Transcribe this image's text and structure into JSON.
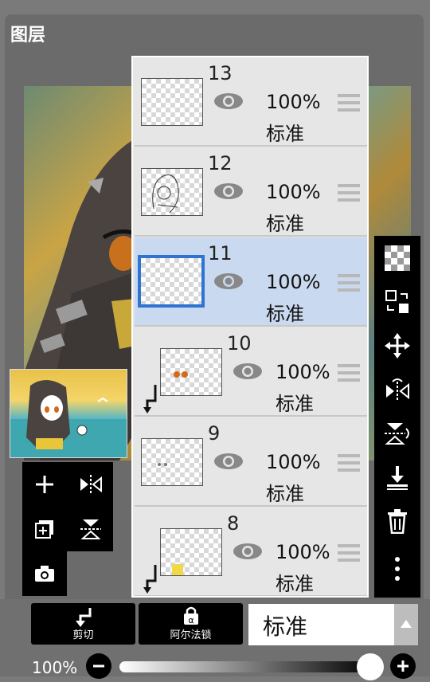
{
  "header": {
    "title": "图层"
  },
  "layers": [
    {
      "number": "13",
      "opacity": "100%",
      "mode": "标准",
      "clipped": false,
      "selected": false
    },
    {
      "number": "12",
      "opacity": "100%",
      "mode": "标准",
      "clipped": false,
      "selected": false
    },
    {
      "number": "11",
      "opacity": "100%",
      "mode": "标准",
      "clipped": false,
      "selected": true
    },
    {
      "number": "10",
      "opacity": "100%",
      "mode": "标准",
      "clipped": true,
      "selected": false
    },
    {
      "number": "9",
      "opacity": "100%",
      "mode": "标准",
      "clipped": false,
      "selected": false
    },
    {
      "number": "8",
      "opacity": "100%",
      "mode": "标准",
      "clipped": true,
      "selected": false
    }
  ],
  "bottom": {
    "clip_label": "剪切",
    "alpha_lock_label": "阿尔法锁",
    "blend_mode": "标准",
    "opacity_label": "100%",
    "opacity_value": 1.0
  },
  "colors": {
    "selection": "#2f74d0",
    "selected_bg": "#c9d9ef"
  }
}
